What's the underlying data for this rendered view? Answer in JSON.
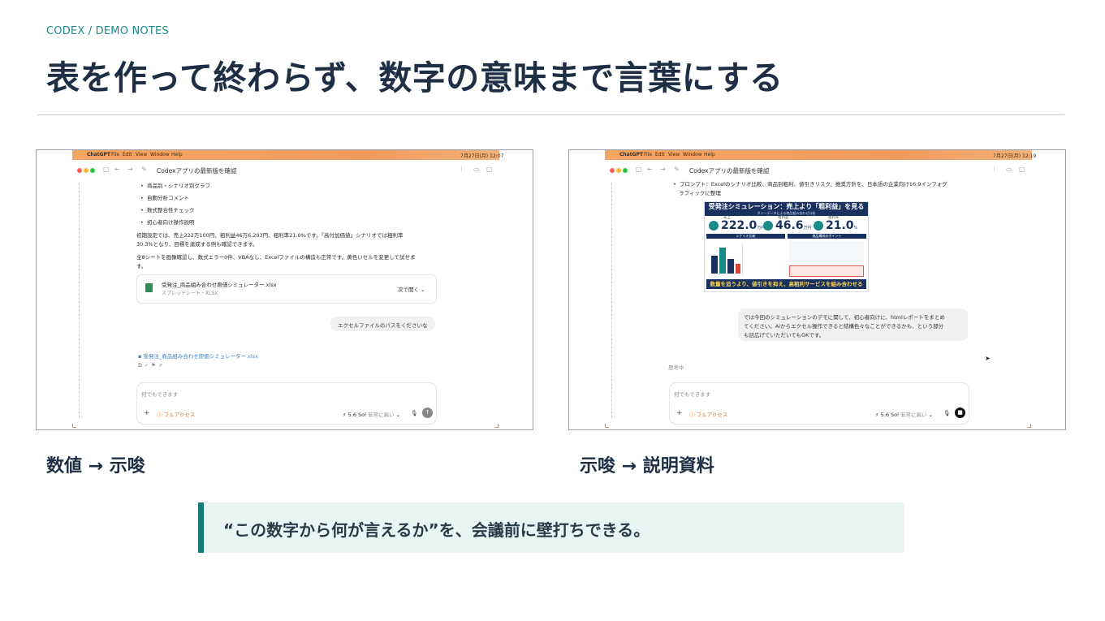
{
  "eyebrow": "CODEX / DEMO NOTES",
  "title": "表を作って終わらず、数字の意味まで言葉にする",
  "colors": {
    "accent": "#167a78",
    "title": "#1d2e45",
    "callout_bg": "#eaf5f3",
    "menubar": "#f4a560"
  },
  "left_screenshot": {
    "menubar": {
      "app": "ChatGPT",
      "items": [
        "File",
        "Edit",
        "View",
        "Window",
        "Help"
      ],
      "clock": "7月27日(月) 12:07"
    },
    "window_title": "Codexアプリの最新版を確認",
    "bullets": [
      "商品別・シナリオ別グラフ",
      "自動分析コメント",
      "数式整合性チェック",
      "初心者向け操作説明"
    ],
    "para1": [
      "初期設定では、売上222万100円、粗利益46万6,203円、粗利率21.0%です。「高付加価値」シナリオでは粗利率",
      "30.3%となり、目標を達成する例も確認できます。"
    ],
    "para2": [
      "全8シートを画像確認し、数式エラー0件、VBAなし、Excelファイルの構造も正常です。黄色いセルを変更して試せま",
      "す。"
    ],
    "file_card": {
      "name": "受発注_商品組み合わせ原価シミュレーター.xlsx",
      "type": "スプレッドシート・XLSX",
      "action": "次で開く"
    },
    "user_message": "エクセルファイルのパスをくださいな",
    "file_link": "受発注_商品組み合わせ原価シミュレーター.xlsx",
    "composer": {
      "placeholder": "何でもできます",
      "access": "フルアクセス",
      "model": "5.6 Sol",
      "effort": "非常に高い"
    }
  },
  "right_screenshot": {
    "menubar": {
      "app": "ChatGPT",
      "items": [
        "File",
        "Edit",
        "View",
        "Window",
        "Help"
      ],
      "clock": "7月27日(月) 12:19"
    },
    "window_title": "Codexアプリの最新版を確認",
    "prompt_line": [
      "プロンプト：Excelのシナリオ比較、商品別粗利、値引きリスク、推奨方針を、日本語の企業向け16:9インフォグ",
      "ラフィックに整理"
    ],
    "infographic": {
      "title": "受発注シミュレーション：売上より「粗利益」を見る",
      "subtitle": "ダミーデータによる商品組み合わせ分析",
      "kpis": [
        {
          "label": "売上",
          "value": "222.0",
          "unit": "万円"
        },
        {
          "label": "粗利益",
          "value": "46.6",
          "unit": "万円"
        },
        {
          "label": "粗利率",
          "value": "21.0",
          "unit": "%"
        }
      ],
      "left_band": "シナリオ比較",
      "right_band": "商品構成のポイント",
      "bars": [
        0.55,
        0.8,
        0.45,
        0.3
      ],
      "footer": "数量を追うより、値引きを抑え、高粗利サービスを組み合わせる"
    },
    "user_message": [
      "では今回のシミュレーションのデモに関して、初心者向けに、htmlレポートをまとめ",
      "てください。Aiからエクセル操作できると結構色々なことができるかも、という部分",
      "も話広げていただいてもOKです。"
    ],
    "thinking": "思考中",
    "composer": {
      "placeholder": "何でもできます",
      "access": "フルアクセス",
      "model": "5.6 Sol",
      "effort": "非常に高い"
    }
  },
  "caption_left": "数値 → 示唆",
  "caption_right": "示唆 → 説明資料",
  "callout": "“この数字から何が言えるか”を、会議前に壁打ちできる。"
}
